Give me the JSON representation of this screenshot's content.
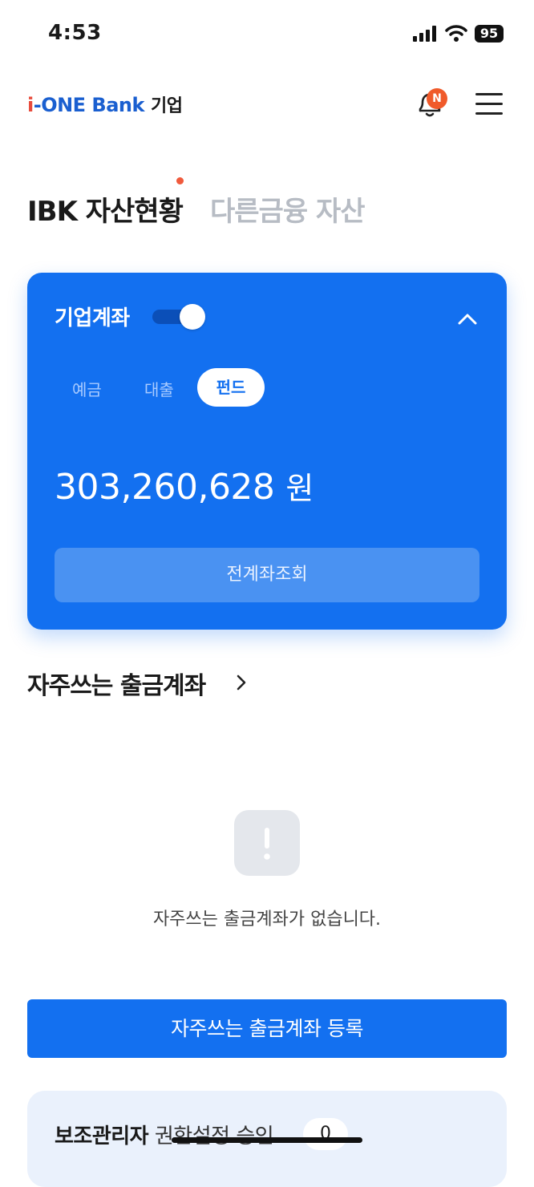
{
  "status_bar": {
    "time": "4:53",
    "battery": "95"
  },
  "header": {
    "logo_i": "i",
    "logo_main": "-ONE Bank",
    "logo_sub": "기업",
    "notification_badge": "N"
  },
  "tabs": [
    {
      "label": "IBK 자산현황",
      "active": true
    },
    {
      "label": "다른금융 자산",
      "active": false
    }
  ],
  "asset_card": {
    "title": "기업계좌",
    "toggle_on": true,
    "segments": [
      {
        "label": "예금",
        "selected": false
      },
      {
        "label": "대출",
        "selected": false
      },
      {
        "label": "펀드",
        "selected": true
      }
    ],
    "amount": "303,260,628",
    "unit": "원",
    "view_all_label": "전계좌조회"
  },
  "frequent_accounts": {
    "title": "자주쓰는 출금계좌",
    "empty_message": "자주쓰는 출금계좌가 없습니다.",
    "register_label": "자주쓰는 출금계좌 등록"
  },
  "sub_admin": {
    "title_bold": "보조관리자",
    "title_rest": " 권한설정 승인",
    "count": "0"
  },
  "colors": {
    "primary": "#1370f0",
    "accent_red": "#f05a2a",
    "inactive_tab": "#b7bcc4"
  }
}
